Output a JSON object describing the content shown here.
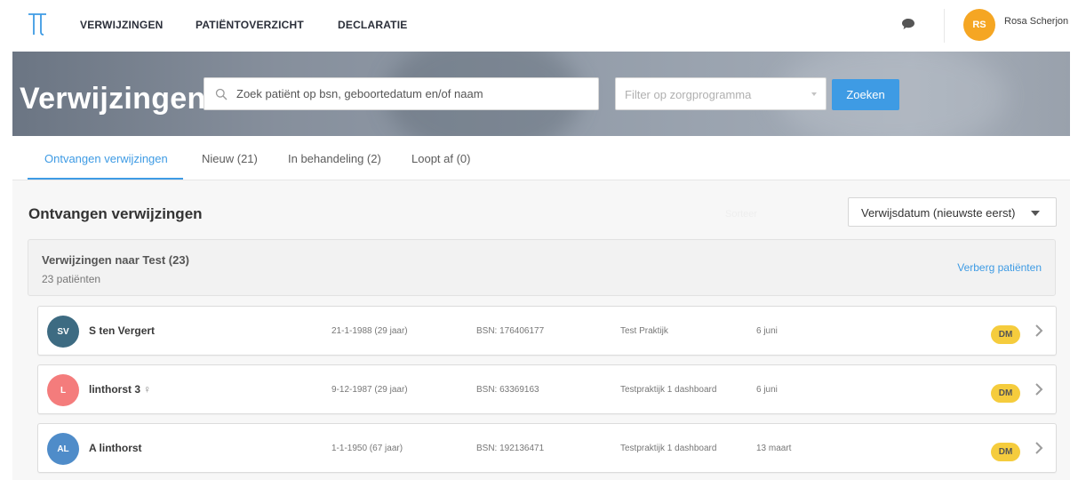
{
  "nav": {
    "items": [
      "VERWIJZINGEN",
      "PATIËNTOVERZICHT",
      "DECLARATIE"
    ],
    "user": {
      "initials": "RS",
      "name": "Rosa Scherjon",
      "avatar_color": "#f5a623"
    }
  },
  "hero": {
    "title": "Verwijzingen",
    "search_placeholder": "Zoek patiënt op bsn, geboortedatum en/of naam",
    "filter_placeholder": "Filter op zorgprogramma",
    "search_button": "Zoeken"
  },
  "tabs": [
    {
      "label": "Ontvangen verwijzingen",
      "active": true
    },
    {
      "label": "Nieuw (21)"
    },
    {
      "label": "In behandeling (2)"
    },
    {
      "label": "Loopt af (0)"
    }
  ],
  "main": {
    "title": "Ontvangen verwijzingen",
    "sort_label": "Sorteer",
    "sort_value": "Verwijsdatum (nieuwste eerst)"
  },
  "group": {
    "title": "Verwijzingen naar Test (23)",
    "subtitle": "23 patiënten",
    "toggle": "Verberg patiënten"
  },
  "patients": [
    {
      "initials": "SV",
      "name": "S ten Vergert",
      "gender": "",
      "dob": "21-1-1988 (29 jaar)",
      "bsn": "BSN: 176406177",
      "practice": "Test Praktijk",
      "date": "6 juni",
      "badge": "DM",
      "color": "#3d6b82"
    },
    {
      "initials": "L",
      "name": "linthorst 3",
      "gender": "♀",
      "dob": "9-12-1987 (29 jaar)",
      "bsn": "BSN: 63369163",
      "practice": "Testpraktijk 1 dashboard",
      "date": "6 juni",
      "badge": "DM",
      "color": "#f47c7c"
    },
    {
      "initials": "AL",
      "name": "A linthorst",
      "gender": "",
      "dob": "1-1-1950 (67 jaar)",
      "bsn": "BSN: 192136471",
      "practice": "Testpraktijk 1 dashboard",
      "date": "13 maart",
      "badge": "DM",
      "color": "#4f8cc9"
    }
  ],
  "colors": {
    "accent": "#3e9be4",
    "badge": "#f5cc3d"
  }
}
